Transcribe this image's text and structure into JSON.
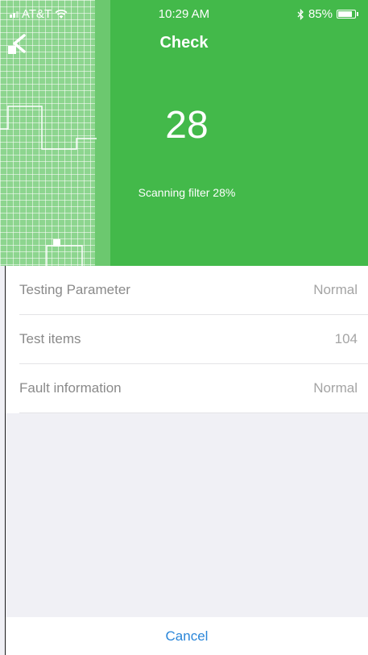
{
  "status_bar": {
    "carrier": "AT&T",
    "time": "10:29 AM",
    "battery": "85%",
    "battery_level": 0.85
  },
  "header": {
    "title": "Check",
    "progress_number": "28",
    "scan_status": "Scanning filter 28%",
    "accent_color": "#43b94a"
  },
  "rows": [
    {
      "label": "Testing Parameter",
      "value": "Normal"
    },
    {
      "label": "Test items",
      "value": "104"
    },
    {
      "label": "Fault information",
      "value": "Normal"
    }
  ],
  "footer": {
    "cancel_label": "Cancel",
    "link_color": "#2a86d9"
  }
}
